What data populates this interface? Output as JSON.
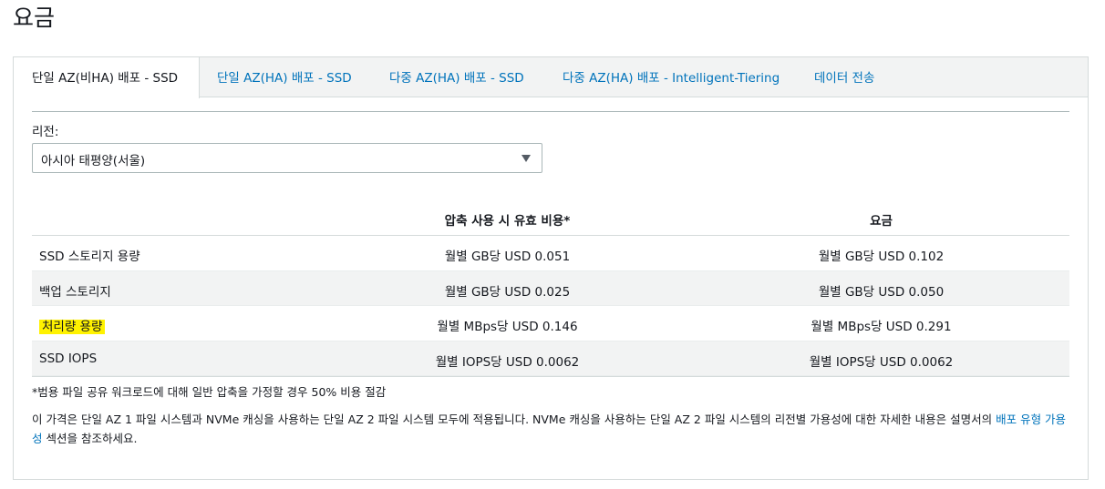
{
  "page": {
    "title": "요금"
  },
  "tabs": [
    {
      "label": "단일 AZ(비HA) 배포 - SSD",
      "active": true
    },
    {
      "label": "단일 AZ(HA) 배포 - SSD",
      "active": false
    },
    {
      "label": "다중 AZ(HA) 배포 - SSD",
      "active": false
    },
    {
      "label": "다중 AZ(HA) 배포 - Intelligent-Tiering",
      "active": false
    },
    {
      "label": "데이터 전송",
      "active": false
    }
  ],
  "region": {
    "label": "리전:",
    "selected": "아시아 태평양(서울)"
  },
  "table": {
    "headers": [
      "",
      "압축 사용 시 유효 비용*",
      "요금"
    ],
    "rows": [
      {
        "name": "SSD 스토리지 용량",
        "effective": "월별 GB당 USD 0.051",
        "price": "월별 GB당 USD 0.102"
      },
      {
        "name": "백업 스토리지",
        "effective": "월별 GB당 USD 0.025",
        "price": "월별 GB당 USD 0.050"
      },
      {
        "name": "처리량 용량",
        "effective": "월별 MBps당 USD 0.146",
        "price": "월별 MBps당 USD 0.291"
      },
      {
        "name": "SSD IOPS",
        "effective": "월별 IOPS당 USD 0.0062",
        "price": "월별 IOPS당 USD 0.0062"
      }
    ]
  },
  "footnote": "*범용 파일 공유 워크로드에 대해 일반 압축을 가정할 경우 50% 비용 절감",
  "description": {
    "before": "이 가격은 단일 AZ 1 파일 시스템과 NVMe 캐싱을 사용하는 단일 AZ 2 파일 시스템 모두에 적용됩니다. NVMe 캐싱을 사용하는 단일 AZ 2 파일 시스템의 리전별 가용성에 대한 자세한 내용은 설명서의 ",
    "link": "배포 유형 가용성",
    "after": " 섹션을 참조하세요."
  },
  "colors": {
    "link": "#0073bb",
    "highlight": "#fff200",
    "tab_bar": "#f2f3f3",
    "alt_row": "#f2f3f3"
  }
}
